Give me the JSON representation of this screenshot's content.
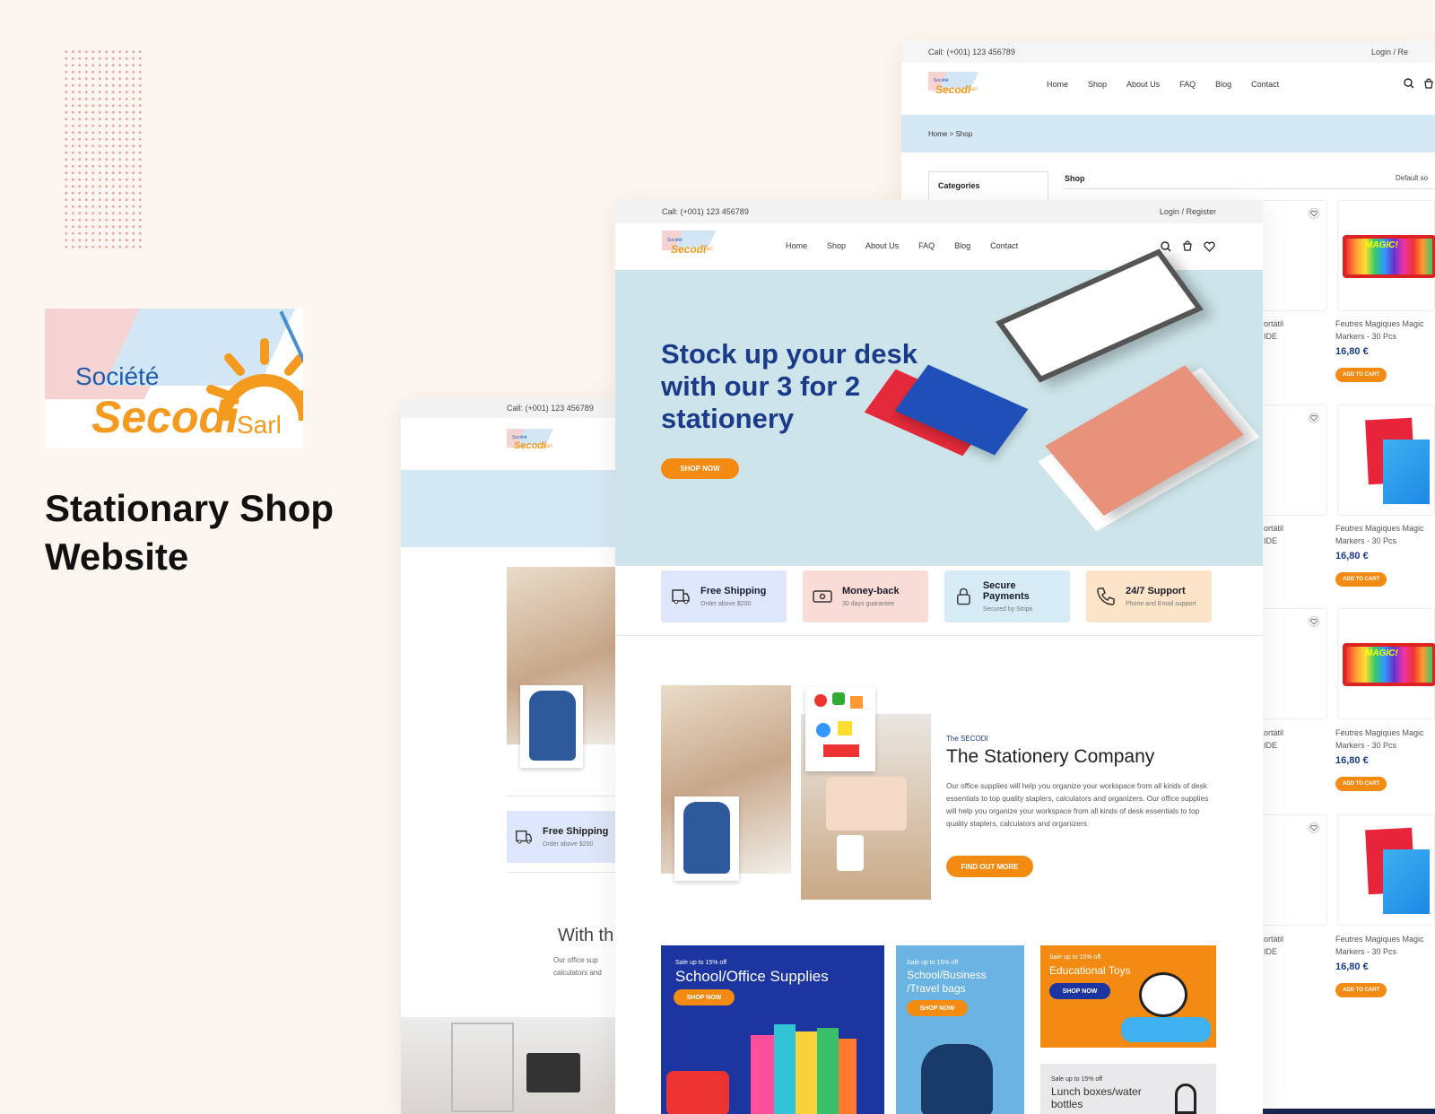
{
  "presentation": {
    "title_line1": "Stationary Shop",
    "title_line2": "Website"
  },
  "logo": {
    "line1": "Société",
    "line2": "Secodi",
    "line3": "Sarl"
  },
  "topbar": {
    "call": "Call: (+001) 123 456789",
    "login": "Login",
    "sep": "/",
    "register": "Register"
  },
  "nav": {
    "items": [
      "Home",
      "Shop",
      "About Us",
      "FAQ",
      "Blog",
      "Contact"
    ]
  },
  "shop_page": {
    "login_partial": "Login / Re",
    "breadcrumb": "Home > Shop",
    "categories": "Categories",
    "shop_label": "Shop",
    "sort": "Default so",
    "partial_text_a": "ortátil",
    "partial_text_b": "IDE",
    "products": [
      {
        "name1": "Feutres Magiques Magic",
        "name2": "Markers - 30 Pcs",
        "price": "16,80 €",
        "cta": "ADD TO CART"
      },
      {
        "name1": "Feutres Magiques Magic",
        "name2": "Markers - 30 Pcs",
        "price": "16,80 €",
        "cta": "ADD TO CART"
      },
      {
        "name1": "Feutres Magiques Magic",
        "name2": "Markers - 30 Pcs",
        "price": "16,80 €",
        "cta": "ADD TO CART"
      },
      {
        "name1": "Feutres Magiques Magic",
        "name2": "Markers - 30 Pcs",
        "price": "16,80 €",
        "cta": "ADD TO CART"
      }
    ],
    "marker_brand": "MAGIC!"
  },
  "hero": {
    "line1": "Stock up your desk",
    "line2": "with our 3 for 2",
    "line3": "stationery",
    "cta": "SHOP NOW"
  },
  "features": [
    {
      "title": "Free Shipping",
      "sub": "Order above $200",
      "icon": "truck-icon",
      "color": "#dde6fa"
    },
    {
      "title": "Money-back",
      "sub": "30 days guarantee",
      "icon": "money-icon",
      "color": "#fadcd7"
    },
    {
      "title": "Secure Payments",
      "sub": "Secured by Stripe",
      "icon": "lock-icon",
      "color": "#d6ebf5"
    },
    {
      "title": "24/7 Support",
      "sub": "Phone and Email support",
      "icon": "phone-icon",
      "color": "#fde4c8"
    }
  ],
  "about": {
    "eyebrow": "The SECODI",
    "title": "The Stationery Company",
    "body": "Our office supplies will help you organize your workspace from all kinds of desk essentials to top quality staplers, calculators and organizers. Our office supplies will help you organize your workspace from all kinds of desk essentials to top quality staplers, calculators and organizers.",
    "cta": "FIND OUT MORE"
  },
  "categories_grid": [
    {
      "sale": "Sale up to 15% off",
      "title": "School/Office Supplies",
      "cta": "SHOP NOW"
    },
    {
      "sale": "Sale up to 15% off",
      "title1": "School/Business",
      "title2": "/Travel bags",
      "cta": "SHOP NOW"
    },
    {
      "sale": "Sale up to 15% off",
      "title": "Educational Toys",
      "cta": "SHOP NOW"
    },
    {
      "sale": "Sale up to 15% off",
      "title1": "Lunch boxes/water",
      "title2": "bottles"
    }
  ],
  "mobile_page": {
    "call": "Call: (+001) 123 456789",
    "feature_title": "Free Shipping",
    "feature_sub": "Order above $200",
    "heading_partial": "With th",
    "text1": "Our office sup",
    "text2": "calculators and"
  },
  "colors": {
    "accent": "#f38a12",
    "navy": "#1a3a8a",
    "hero_bg": "#cde5ea",
    "breadcrumb_bg": "#d4e8f6",
    "background": "#fdf6f0"
  }
}
